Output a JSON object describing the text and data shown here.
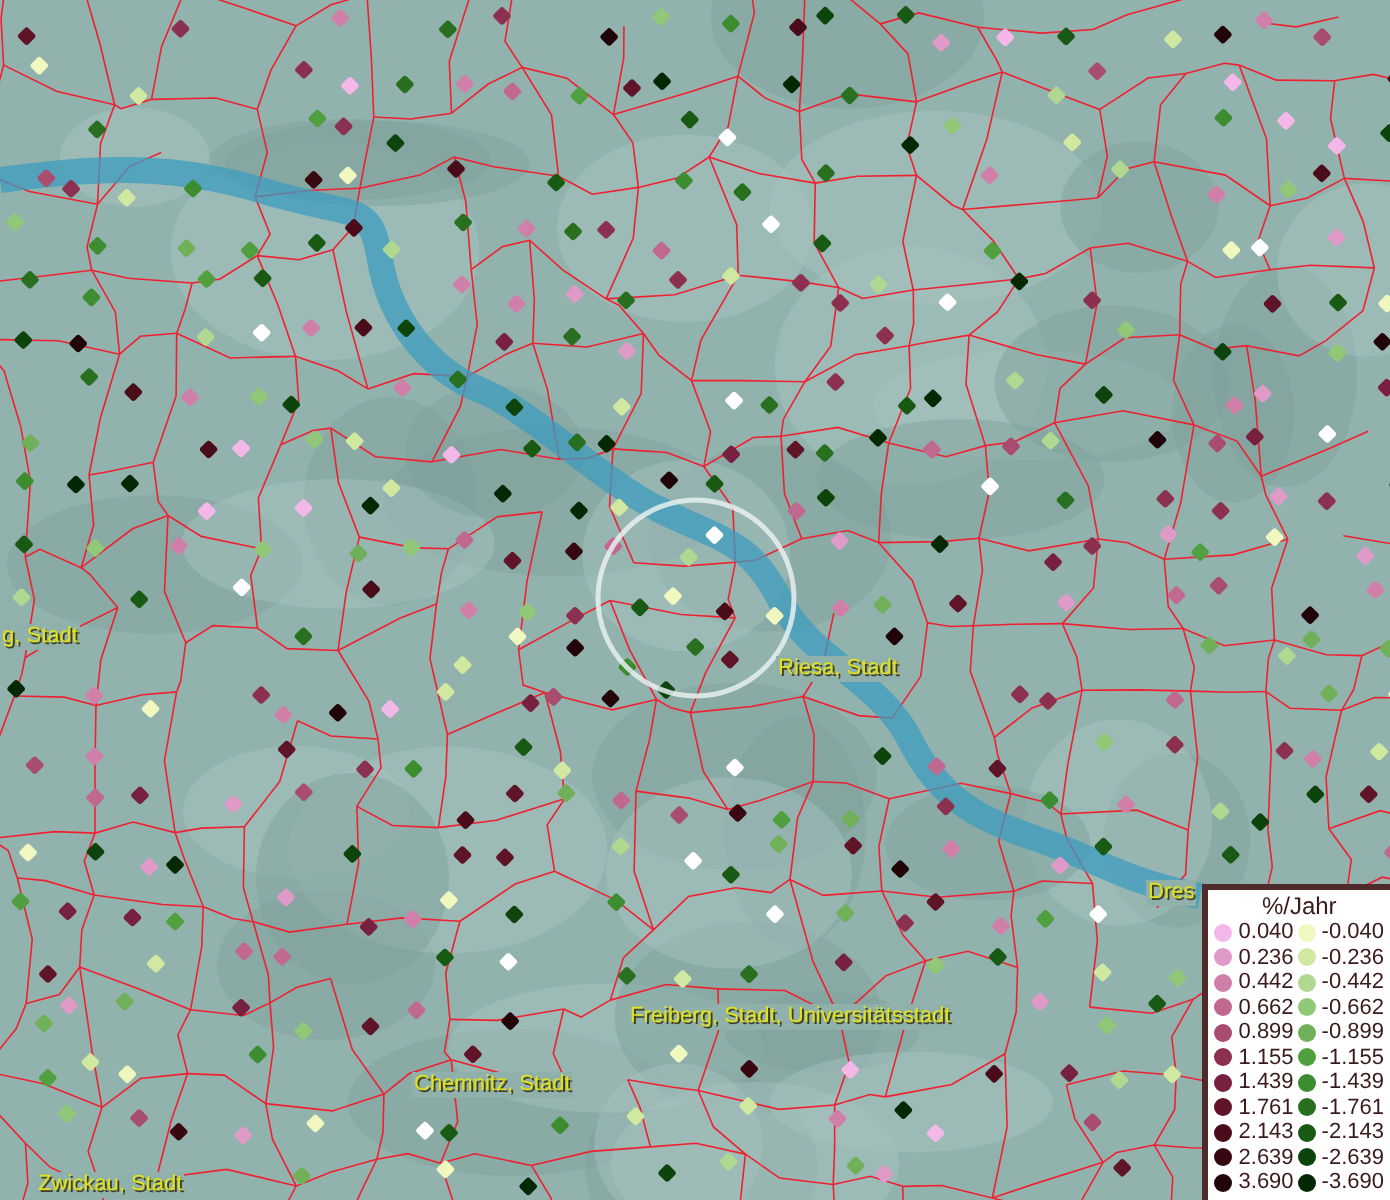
{
  "map": {
    "place_labels": [
      {
        "text": "g, Stadt"
      },
      {
        "text": "Riesa, Stadt"
      },
      {
        "text": "Dres"
      },
      {
        "text": "Freiberg, Stadt, Universitätsstadt"
      },
      {
        "text": "Chemnitz, Stadt"
      },
      {
        "text": "Zwickau, Stadt"
      }
    ]
  },
  "legend": {
    "title": "%/Jahr",
    "positive": [
      {
        "label": "0.040",
        "color": "#f4b8e8"
      },
      {
        "label": "0.236",
        "color": "#e09ac8"
      },
      {
        "label": "0.442",
        "color": "#d080a8"
      },
      {
        "label": "0.662",
        "color": "#c06890"
      },
      {
        "label": "0.899",
        "color": "#a84c70"
      },
      {
        "label": "1.155",
        "color": "#8c3050"
      },
      {
        "label": "1.439",
        "color": "#782040"
      },
      {
        "label": "1.761",
        "color": "#601428"
      },
      {
        "label": "2.143",
        "color": "#4a0c18"
      },
      {
        "label": "2.639",
        "color": "#380810"
      },
      {
        "label": "3.690",
        "color": "#200408"
      }
    ],
    "negative": [
      {
        "label": "-0.040",
        "color": "#f0f8c0"
      },
      {
        "label": "-0.236",
        "color": "#d0e8a0"
      },
      {
        "label": "-0.442",
        "color": "#b0d890"
      },
      {
        "label": "-0.662",
        "color": "#90c878"
      },
      {
        "label": "-0.899",
        "color": "#70b058"
      },
      {
        "label": "-1.155",
        "color": "#50a040"
      },
      {
        "label": "-1.439",
        "color": "#3c8c30"
      },
      {
        "label": "-1.761",
        "color": "#287020"
      },
      {
        "label": "-2.143",
        "color": "#185a14"
      },
      {
        "label": "-2.639",
        "color": "#0c440c"
      },
      {
        "label": "-3.690",
        "color": "#042804"
      }
    ]
  }
}
